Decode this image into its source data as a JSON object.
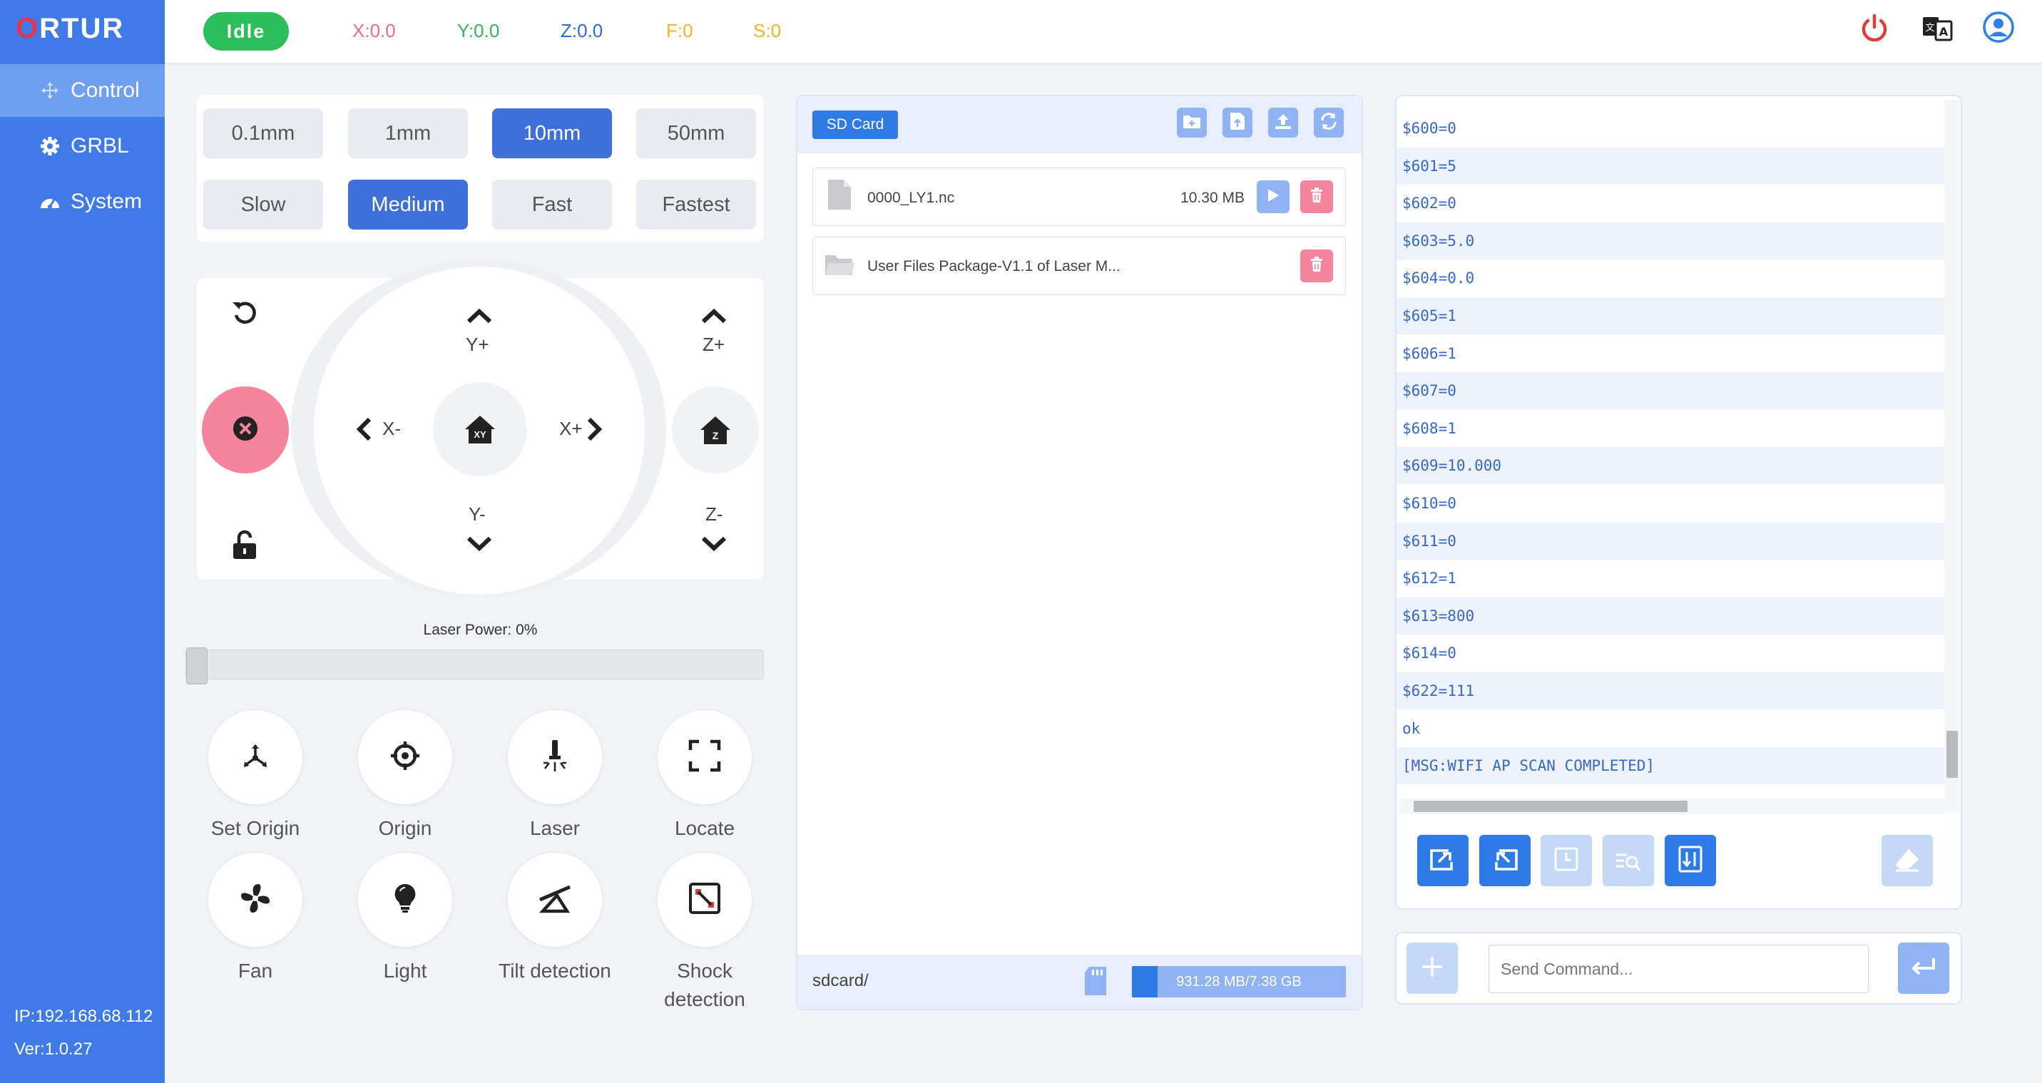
{
  "app": {
    "logo": "ORTUR"
  },
  "sidebar": {
    "items": [
      {
        "label": "Control",
        "icon": "move-icon"
      },
      {
        "label": "GRBL",
        "icon": "gear-icon"
      },
      {
        "label": "System",
        "icon": "dashboard-icon"
      }
    ],
    "ip": "IP:192.168.68.112",
    "version": "Ver:1.0.27"
  },
  "header": {
    "status": "Idle",
    "x": "X:0.0",
    "y": "Y:0.0",
    "z": "Z:0.0",
    "f": "F:0",
    "s": "S:0",
    "colors": {
      "x": "#f06a8c",
      "y": "#34b35a",
      "z": "#2f6bd8",
      "f": "#f0b428",
      "s": "#f0b428"
    }
  },
  "steps": {
    "distances": [
      "0.1mm",
      "1mm",
      "10mm",
      "50mm"
    ],
    "speeds": [
      "Slow",
      "Medium",
      "Fast",
      "Fastest"
    ],
    "selected_distance": "10mm",
    "selected_speed": "Medium"
  },
  "jog": {
    "y_plus": "Y+",
    "y_minus": "Y-",
    "x_minus": "X-",
    "x_plus": "X+",
    "z_plus": "Z+",
    "z_minus": "Z-",
    "home_xy": "XY",
    "home_z": "Z"
  },
  "laser": {
    "power_label": "Laser Power: 0%",
    "power": 0
  },
  "functions": [
    {
      "label": "Set Origin",
      "icon": "set-origin-icon"
    },
    {
      "label": "Origin",
      "icon": "crosshair-icon"
    },
    {
      "label": "Laser",
      "icon": "laser-icon"
    },
    {
      "label": "Locate",
      "icon": "frame-icon"
    },
    {
      "label": "Fan",
      "icon": "fan-icon"
    },
    {
      "label": "Light",
      "icon": "bulb-icon"
    },
    {
      "label": "Tilt detection",
      "icon": "tilt-icon"
    },
    {
      "label": "Shock detection",
      "icon": "shock-icon"
    }
  ],
  "sdcard": {
    "title": "SD Card",
    "files": [
      {
        "name": "0000_LY1.nc",
        "size": "10.30 MB",
        "type": "file"
      },
      {
        "name": "User Files Package-V1.1 of Laser M...",
        "size": "",
        "type": "folder"
      }
    ],
    "path": "sdcard/",
    "usage": "931.28 MB/7.38 GB",
    "usage_fraction": 0.12
  },
  "console": {
    "lines": [
      "$600=0",
      "$601=5",
      "$602=0",
      "$603=5.0",
      "$604=0.0",
      "$605=1",
      "$606=1",
      "$607=0",
      "$608=1",
      "$609=10.000",
      "$610=0",
      "$611=0",
      "$612=1",
      "$613=800",
      "$614=0",
      "$622=111",
      "ok",
      "[MSG:WIFI AP SCAN COMPLETED]"
    ],
    "command_placeholder": "Send Command..."
  }
}
